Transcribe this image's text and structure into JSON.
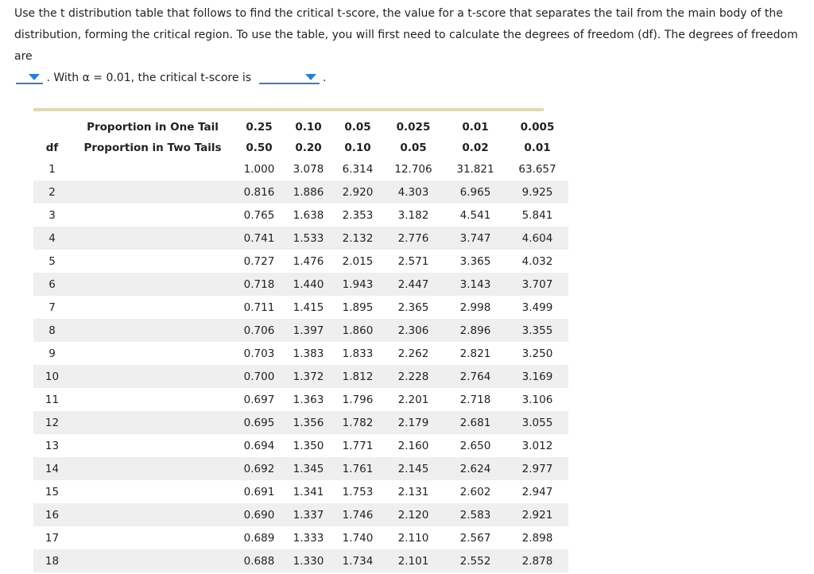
{
  "prompt": {
    "line1": "Use the t distribution table that follows to find the critical t-score, the value for a t-score that separates the tail from the main body of the",
    "line2": "distribution, forming the critical region. To use the table, you will first need to calculate the degrees of freedom (df). The degrees of freedom are",
    "mid_text": ". With α = 0.01, the critical t-score is",
    "end_text": ".",
    "df_selected": "",
    "tscore_selected": ""
  },
  "table": {
    "df_label": "df",
    "one_tail_label": "Proportion in One Tail",
    "two_tail_label": "Proportion in Two Tails",
    "one_tail": [
      "0.25",
      "0.10",
      "0.05",
      "0.025",
      "0.01",
      "0.005"
    ],
    "two_tail": [
      "0.50",
      "0.20",
      "0.10",
      "0.05",
      "0.02",
      "0.01"
    ],
    "rows": [
      {
        "df": "1",
        "v": [
          "1.000",
          "3.078",
          "6.314",
          "12.706",
          "31.821",
          "63.657"
        ]
      },
      {
        "df": "2",
        "v": [
          "0.816",
          "1.886",
          "2.920",
          "4.303",
          "6.965",
          "9.925"
        ]
      },
      {
        "df": "3",
        "v": [
          "0.765",
          "1.638",
          "2.353",
          "3.182",
          "4.541",
          "5.841"
        ]
      },
      {
        "df": "4",
        "v": [
          "0.741",
          "1.533",
          "2.132",
          "2.776",
          "3.747",
          "4.604"
        ]
      },
      {
        "df": "5",
        "v": [
          "0.727",
          "1.476",
          "2.015",
          "2.571",
          "3.365",
          "4.032"
        ]
      },
      {
        "df": "6",
        "v": [
          "0.718",
          "1.440",
          "1.943",
          "2.447",
          "3.143",
          "3.707"
        ]
      },
      {
        "df": "7",
        "v": [
          "0.711",
          "1.415",
          "1.895",
          "2.365",
          "2.998",
          "3.499"
        ]
      },
      {
        "df": "8",
        "v": [
          "0.706",
          "1.397",
          "1.860",
          "2.306",
          "2.896",
          "3.355"
        ]
      },
      {
        "df": "9",
        "v": [
          "0.703",
          "1.383",
          "1.833",
          "2.262",
          "2.821",
          "3.250"
        ]
      },
      {
        "df": "10",
        "v": [
          "0.700",
          "1.372",
          "1.812",
          "2.228",
          "2.764",
          "3.169"
        ]
      },
      {
        "df": "11",
        "v": [
          "0.697",
          "1.363",
          "1.796",
          "2.201",
          "2.718",
          "3.106"
        ]
      },
      {
        "df": "12",
        "v": [
          "0.695",
          "1.356",
          "1.782",
          "2.179",
          "2.681",
          "3.055"
        ]
      },
      {
        "df": "13",
        "v": [
          "0.694",
          "1.350",
          "1.771",
          "2.160",
          "2.650",
          "3.012"
        ]
      },
      {
        "df": "14",
        "v": [
          "0.692",
          "1.345",
          "1.761",
          "2.145",
          "2.624",
          "2.977"
        ]
      },
      {
        "df": "15",
        "v": [
          "0.691",
          "1.341",
          "1.753",
          "2.131",
          "2.602",
          "2.947"
        ]
      },
      {
        "df": "16",
        "v": [
          "0.690",
          "1.337",
          "1.746",
          "2.120",
          "2.583",
          "2.921"
        ]
      },
      {
        "df": "17",
        "v": [
          "0.689",
          "1.333",
          "1.740",
          "2.110",
          "2.567",
          "2.898"
        ]
      },
      {
        "df": "18",
        "v": [
          "0.688",
          "1.330",
          "1.734",
          "2.101",
          "2.552",
          "2.878"
        ]
      }
    ]
  }
}
